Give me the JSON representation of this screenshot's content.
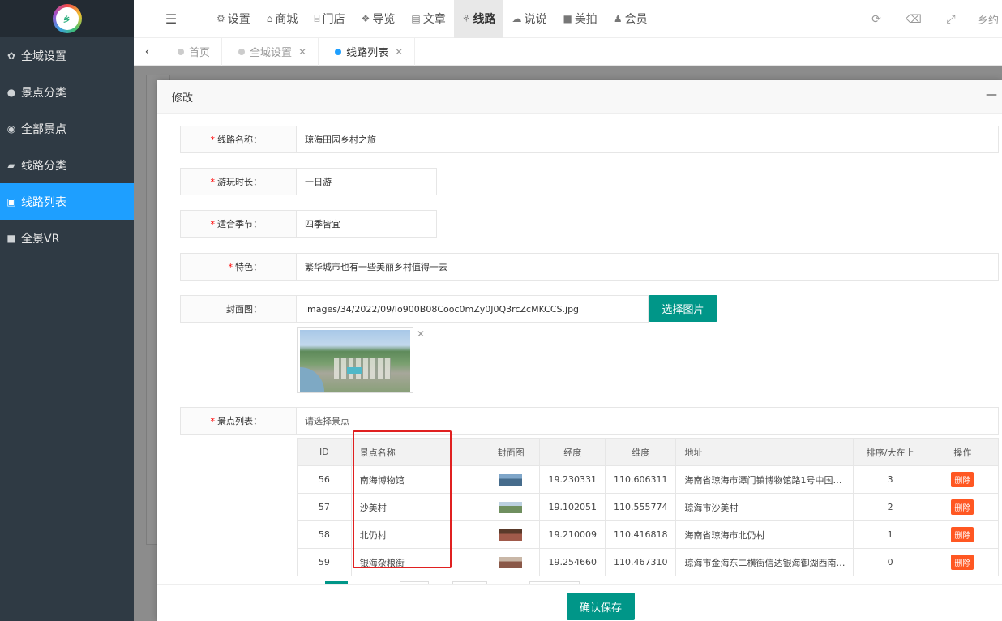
{
  "sidebar": {
    "logo_text": "乡",
    "items": [
      {
        "label": "全域设置",
        "icon": "gear-icon"
      },
      {
        "label": "景点分类",
        "icon": "fire-icon"
      },
      {
        "label": "全部景点",
        "icon": "globe-icon"
      },
      {
        "label": "线路分类",
        "icon": "eraser-icon"
      },
      {
        "label": "线路列表",
        "icon": "picture-icon",
        "active": true
      },
      {
        "label": "全景VR",
        "icon": "video-icon"
      }
    ]
  },
  "topnav": {
    "items": [
      {
        "label": "设置",
        "icon": "gears-icon"
      },
      {
        "label": "商城",
        "icon": "shop-icon"
      },
      {
        "label": "门店",
        "icon": "bank-icon"
      },
      {
        "label": "导览",
        "icon": "cubes-icon"
      },
      {
        "label": "文章",
        "icon": "newspaper-icon"
      },
      {
        "label": "线路",
        "icon": "route-icon",
        "active": true
      },
      {
        "label": "说说",
        "icon": "wechat-icon"
      },
      {
        "label": "美拍",
        "icon": "video-icon"
      },
      {
        "label": "会员",
        "icon": "user-icon"
      }
    ],
    "user_label": "乡约"
  },
  "tabs": [
    {
      "label": "首页",
      "closable": false
    },
    {
      "label": "全域设置",
      "closable": true
    },
    {
      "label": "线路列表",
      "closable": true,
      "active": true
    }
  ],
  "modal": {
    "title": "修改",
    "form": {
      "route_name": {
        "label": "线路名称：",
        "value": "琼海田园乡村之旅"
      },
      "duration": {
        "label": "游玩时长：",
        "value": "一日游"
      },
      "season": {
        "label": "适合季节：",
        "value": "四季皆宜"
      },
      "feature": {
        "label": "特色：",
        "value": "繁华城市也有一些美丽乡村值得一去"
      },
      "cover": {
        "label": "封面图：",
        "value": "images/34/2022/09/Io900B08Cooc0mZy0J0Q3rcZcMKCCS.jpg",
        "button": "选择图片"
      },
      "spots": {
        "label": "景点列表：",
        "placeholder": "请选择景点"
      }
    },
    "table": {
      "headers": [
        "ID",
        "景点名称",
        "封面图",
        "经度",
        "维度",
        "地址",
        "排序/大在上",
        "操作"
      ],
      "rows": [
        {
          "id": "56",
          "name": "南海博物馆",
          "lng": "19.230331",
          "lat": "110.606311",
          "addr": "海南省琼海市潭门镇博物馆路1号中国(…",
          "sort": "3",
          "action": "删除"
        },
        {
          "id": "57",
          "name": "沙美村",
          "lng": "19.102051",
          "lat": "110.555774",
          "addr": "琼海市沙美村",
          "sort": "2",
          "action": "删除"
        },
        {
          "id": "58",
          "name": "北仍村",
          "lng": "19.210009",
          "lat": "110.416818",
          "addr": "海南省琼海市北仍村",
          "sort": "1",
          "action": "删除"
        },
        {
          "id": "59",
          "name": "银海杂粮街",
          "lng": "19.254660",
          "lat": "110.467310",
          "addr": "琼海市金海东二横街信达银海御湖西南…",
          "sort": "0",
          "action": "删除"
        }
      ]
    },
    "save_button": "确认保存"
  }
}
